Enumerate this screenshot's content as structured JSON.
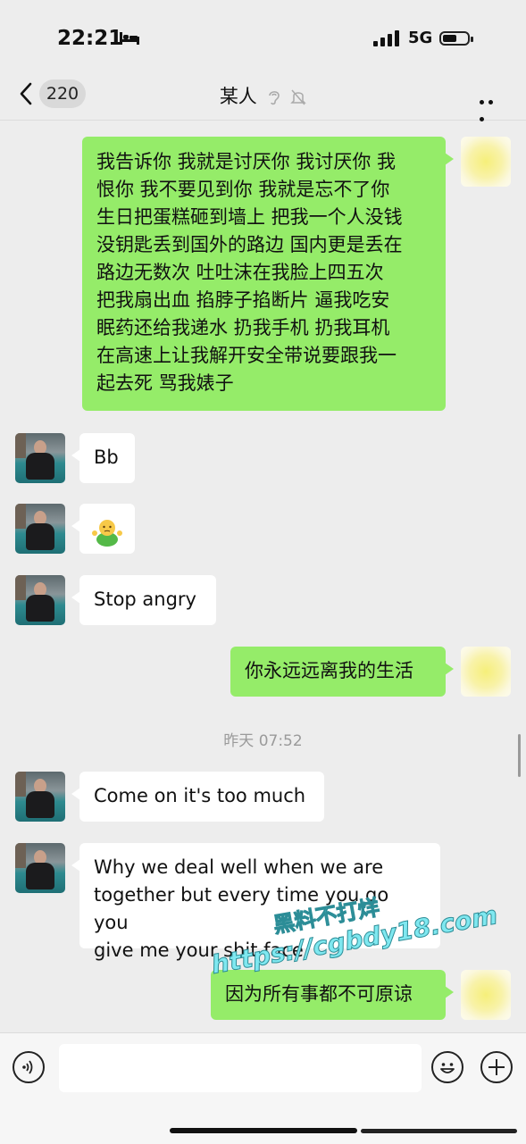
{
  "status_bar": {
    "time": "22:21",
    "network": "5G"
  },
  "nav": {
    "unread_count": "220",
    "title": "某人"
  },
  "messages": [
    {
      "lines": [
        "我告诉你 我就是讨厌你 我讨厌你 我",
        "恨你 我不要见到你  我就是忘不了你",
        "生日把蛋糕砸到墙上 把我一个人没钱",
        "没钥匙丢到国外的路边 国内更是丢在",
        "路边无数次 吐吐沫在我脸上四五次",
        "把我扇出血 掐脖子掐断片 逼我吃安",
        "眠药还给我递水 扔我手机 扔我耳机",
        "在高速上让我解开安全带说要跟我一",
        "起去死 骂我婊子"
      ]
    },
    {
      "text": "Bb"
    },
    {
      "text": "🤷"
    },
    {
      "text": "Stop angry"
    },
    {
      "text": "你永远远离我的生活"
    },
    {
      "text": "Come on it's too much"
    },
    {
      "lines": [
        "Why we deal well when we are",
        "together but every time you go you",
        "give me your shit face"
      ]
    },
    {
      "text": "因为所有事都不可原谅"
    }
  ],
  "timestamp": "昨天 07:52",
  "watermark": {
    "line1": "黑料不打烊",
    "line2": "https://cgbdy18.com"
  },
  "colors": {
    "outgoing_bubble": "#95ec69",
    "incoming_bubble": "#ffffff",
    "background": "#ededed"
  }
}
